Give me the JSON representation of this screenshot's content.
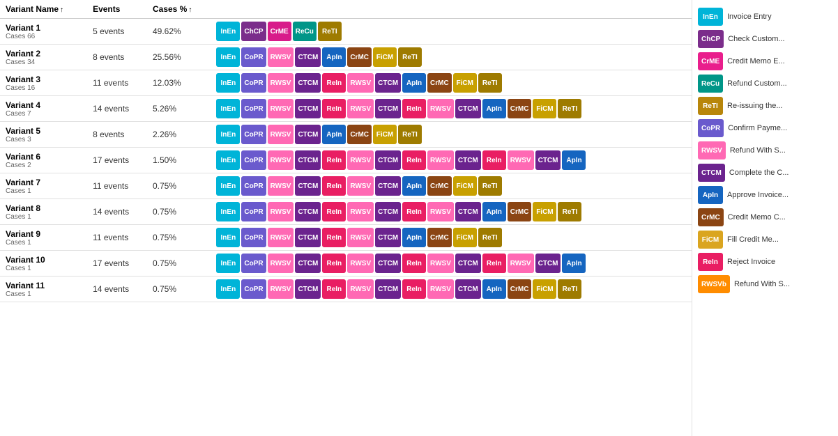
{
  "colors": {
    "InEn": "#00B4D8",
    "ChCP": "#7B2D8B",
    "CrME": "#E91E8C",
    "ReCu": "#009688",
    "ReTI": "#B8860B",
    "CoPR": "#6A5ACD",
    "RWSV": "#FF69B4",
    "CTCM": "#6B238E",
    "ApIn": "#1565C0",
    "CrMC": "#8B4513",
    "FiCM": "#DAA520",
    "ReIn": "#E91E8C",
    "RWSVb": "#FF8C00"
  },
  "headers": {
    "variant_name": "Variant Name",
    "events": "Events",
    "cases_pct": "Cases %"
  },
  "variants": [
    {
      "name": "Variant 1",
      "cases": "Cases 66",
      "events": "5 events",
      "cases_pct": "49.62%",
      "sequence": [
        "InEn",
        "ChCP",
        "CrME",
        "ReCu",
        "ReTI"
      ]
    },
    {
      "name": "Variant 2",
      "cases": "Cases 34",
      "events": "8 events",
      "cases_pct": "25.56%",
      "sequence": [
        "InEn",
        "CoPR",
        "RWSV",
        "CTCM",
        "ApIn",
        "CrMC",
        "FiCM",
        "ReTI"
      ]
    },
    {
      "name": "Variant 3",
      "cases": "Cases 16",
      "events": "11 events",
      "cases_pct": "12.03%",
      "sequence": [
        "InEn",
        "CoPR",
        "RWSV",
        "CTCM",
        "ReIn",
        "RWSV",
        "CTCM",
        "ApIn",
        "CrMC",
        "FiCM",
        "ReTI"
      ]
    },
    {
      "name": "Variant 4",
      "cases": "Cases 7",
      "events": "14 events",
      "cases_pct": "5.26%",
      "sequence": [
        "InEn",
        "CoPR",
        "RWSV",
        "CTCM",
        "ReIn",
        "RWSV",
        "CTCM",
        "ReIn",
        "RWSV",
        "CTCM",
        "ApIn",
        "CrMC",
        "FiCM",
        "ReTI"
      ]
    },
    {
      "name": "Variant 5",
      "cases": "Cases 3",
      "events": "8 events",
      "cases_pct": "2.26%",
      "sequence": [
        "InEn",
        "CoPR",
        "RWSV",
        "CTCM",
        "ApIn",
        "CrMC",
        "FiCM",
        "ReTI"
      ]
    },
    {
      "name": "Variant 6",
      "cases": "Cases 2",
      "events": "17 events",
      "cases_pct": "1.50%",
      "sequence": [
        "InEn",
        "CoPR",
        "RWSV",
        "CTCM",
        "ReIn",
        "RWSV",
        "CTCM",
        "ReIn",
        "RWSV",
        "CTCM",
        "ReIn",
        "RWSV",
        "CTCM",
        "ApIn"
      ]
    },
    {
      "name": "Variant 7",
      "cases": "Cases 1",
      "events": "11 events",
      "cases_pct": "0.75%",
      "sequence": [
        "InEn",
        "CoPR",
        "RWSV",
        "CTCM",
        "ReIn",
        "RWSV",
        "CTCM",
        "ApIn",
        "CrMC",
        "FiCM",
        "ReTI"
      ]
    },
    {
      "name": "Variant 8",
      "cases": "Cases 1",
      "events": "14 events",
      "cases_pct": "0.75%",
      "sequence": [
        "InEn",
        "CoPR",
        "RWSV",
        "CTCM",
        "ReIn",
        "RWSV",
        "CTCM",
        "ReIn",
        "RWSV",
        "CTCM",
        "ApIn",
        "CrMC",
        "FiCM",
        "ReTI"
      ]
    },
    {
      "name": "Variant 9",
      "cases": "Cases 1",
      "events": "11 events",
      "cases_pct": "0.75%",
      "sequence": [
        "InEn",
        "CoPR",
        "RWSV",
        "CTCM",
        "ReIn",
        "RWSV",
        "CTCM",
        "ApIn",
        "CrMC",
        "FiCM",
        "ReTI"
      ]
    },
    {
      "name": "Variant 10",
      "cases": "Cases 1",
      "events": "17 events",
      "cases_pct": "0.75%",
      "sequence": [
        "InEn",
        "CoPR",
        "RWSV",
        "CTCM",
        "ReIn",
        "RWSV",
        "CTCM",
        "ReIn",
        "RWSV",
        "CTCM",
        "ReIn",
        "RWSV",
        "CTCM",
        "ApIn"
      ]
    },
    {
      "name": "Variant 11",
      "cases": "Cases 1",
      "events": "14 events",
      "cases_pct": "0.75%",
      "sequence": [
        "InEn",
        "CoPR",
        "RWSV",
        "CTCM",
        "ReIn",
        "RWSV",
        "CTCM",
        "ReIn",
        "RWSV",
        "CTCM",
        "ApIn",
        "CrMC",
        "FiCM",
        "ReTI"
      ]
    }
  ],
  "legend": [
    {
      "code": "InEn",
      "label": "Invoice Entry",
      "color": "#00B4D8"
    },
    {
      "code": "ChCP",
      "label": "Check Custom...",
      "color": "#7B2D8B"
    },
    {
      "code": "CrME",
      "label": "Credit Memo E...",
      "color": "#E91E8C"
    },
    {
      "code": "ReCu",
      "label": "Refund Custom...",
      "color": "#009688"
    },
    {
      "code": "ReTI",
      "label": "Re-issuing the...",
      "color": "#B8860B"
    },
    {
      "code": "CoPR",
      "label": "Confirm Payme...",
      "color": "#6A5ACD"
    },
    {
      "code": "RWSV",
      "label": "Refund With S...",
      "color": "#FF69B4"
    },
    {
      "code": "CTCM",
      "label": "Complete the C...",
      "color": "#6B238E"
    },
    {
      "code": "ApIn",
      "label": "Approve Invoice...",
      "color": "#1565C0"
    },
    {
      "code": "CrMC",
      "label": "Credit Memo C...",
      "color": "#8B4513"
    },
    {
      "code": "FiCM",
      "label": "Fill Credit Me...",
      "color": "#DAA520"
    },
    {
      "code": "ReIn",
      "label": "Reject Invoice",
      "color": "#E91E63"
    },
    {
      "code": "RWSVb",
      "label": "Refund With S...",
      "color": "#FF8C00"
    }
  ],
  "tag_colors": {
    "InEn": "#00B4D8",
    "ChCP": "#7B2D8B",
    "CrME": "#D81B8A",
    "ReCu": "#009688",
    "ReTI": "#9E7B00",
    "CoPR": "#6A5ACD",
    "RWSV": "#FF69B4",
    "CTCM": "#6B238E",
    "ApIn": "#1565C0",
    "CrMC": "#8B4513",
    "FiCM": "#C8A000",
    "ReIn": "#E91E63",
    "RWSVb": "#FF8C00"
  }
}
